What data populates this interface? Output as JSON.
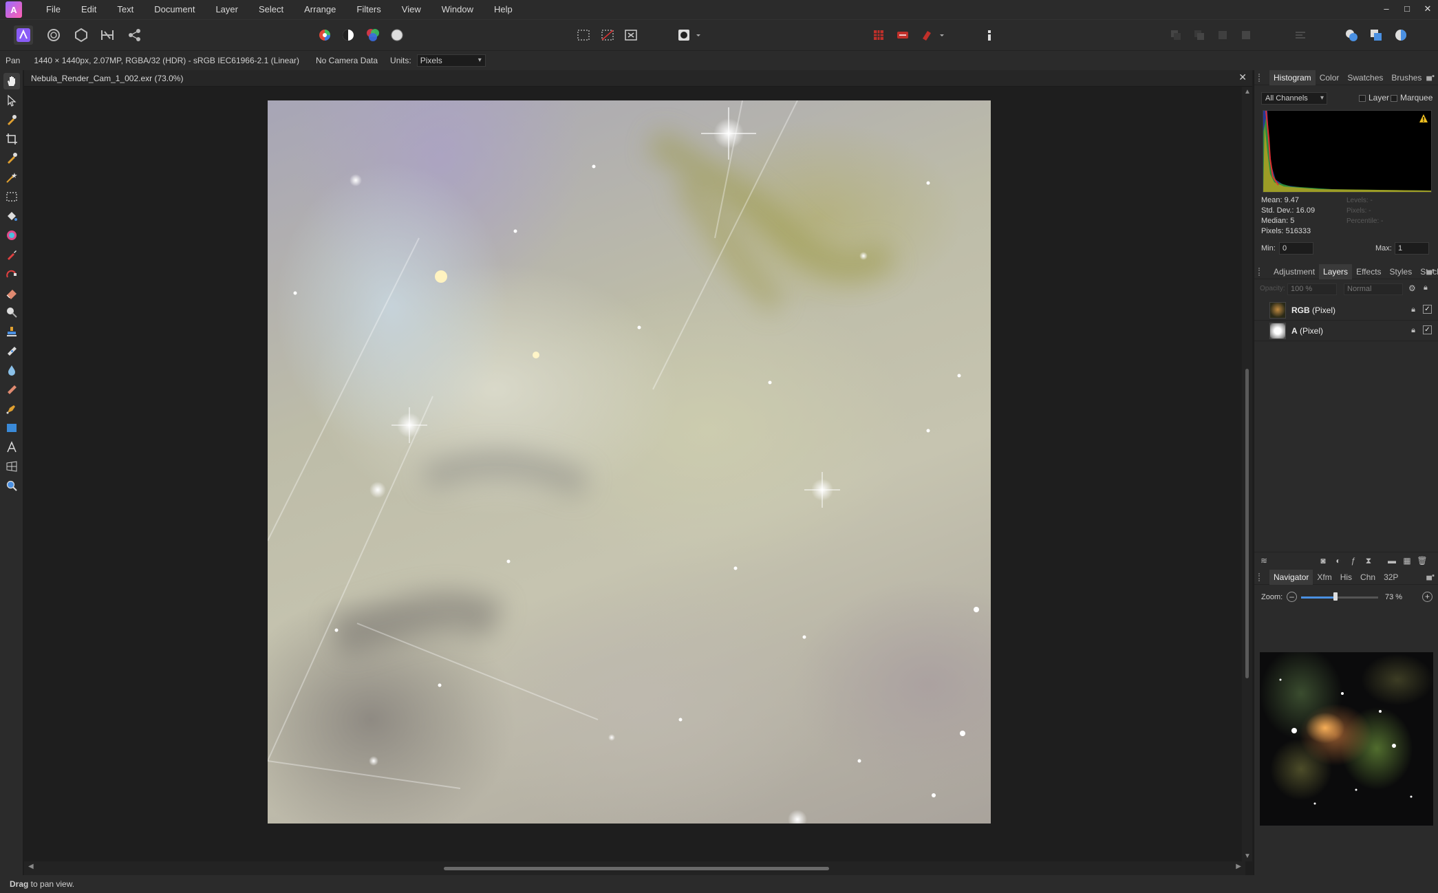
{
  "menu": {
    "items": [
      "File",
      "Edit",
      "Text",
      "Document",
      "Layer",
      "Select",
      "Arrange",
      "Filters",
      "View",
      "Window",
      "Help"
    ]
  },
  "window_controls": {
    "minimize": "–",
    "maximize": "□",
    "close": "✕"
  },
  "context": {
    "tool": "Pan",
    "info": "1440 × 1440px, 2.07MP, RGBA/32 (HDR) - sRGB IEC61966-2.1 (Linear)",
    "camera": "No Camera Data",
    "units_label": "Units:",
    "units_value": "Pixels"
  },
  "document": {
    "tab_title": "Nebula_Render_Cam_1_002.exr (73.0%)",
    "close": "✕"
  },
  "status": {
    "bold": "Drag",
    "rest": " to pan view."
  },
  "histogram_panel": {
    "tabs": [
      "Histogram",
      "Color",
      "Swatches",
      "Brushes"
    ],
    "active_tab": "Histogram",
    "channel": "All Channels",
    "layer_label": "Layer",
    "marquee_label": "Marquee",
    "stats": {
      "mean": "Mean: 9.47",
      "std_dev": "Std. Dev.: 16.09",
      "median": "Median: 5",
      "pixels": "Pixels: 516333"
    },
    "dim_stats": {
      "levels": "Levels: -",
      "pixels": "Pixels: -",
      "percentile": "Percentile: -"
    },
    "min_label": "Min:",
    "min_value": "0",
    "max_label": "Max:",
    "max_value": "1"
  },
  "layers_panel": {
    "tabs": [
      "Adjustment",
      "Layers",
      "Effects",
      "Styles",
      "Stock"
    ],
    "active_tab": "Layers",
    "opacity_label": "Opacity:",
    "opacity": "100 %",
    "blend_mode": "Normal",
    "layers": [
      {
        "name_bold": "RGB",
        "name_rest": " (Pixel)"
      },
      {
        "name_bold": "A",
        "name_rest": " (Pixel)"
      }
    ]
  },
  "navigator_panel": {
    "tabs": [
      "Navigator",
      "Xfm",
      "His",
      "Chn",
      "32P"
    ],
    "active_tab": "Navigator",
    "zoom_label": "Zoom:",
    "zoom_value": "73 %",
    "zoom_level": 0.45
  }
}
